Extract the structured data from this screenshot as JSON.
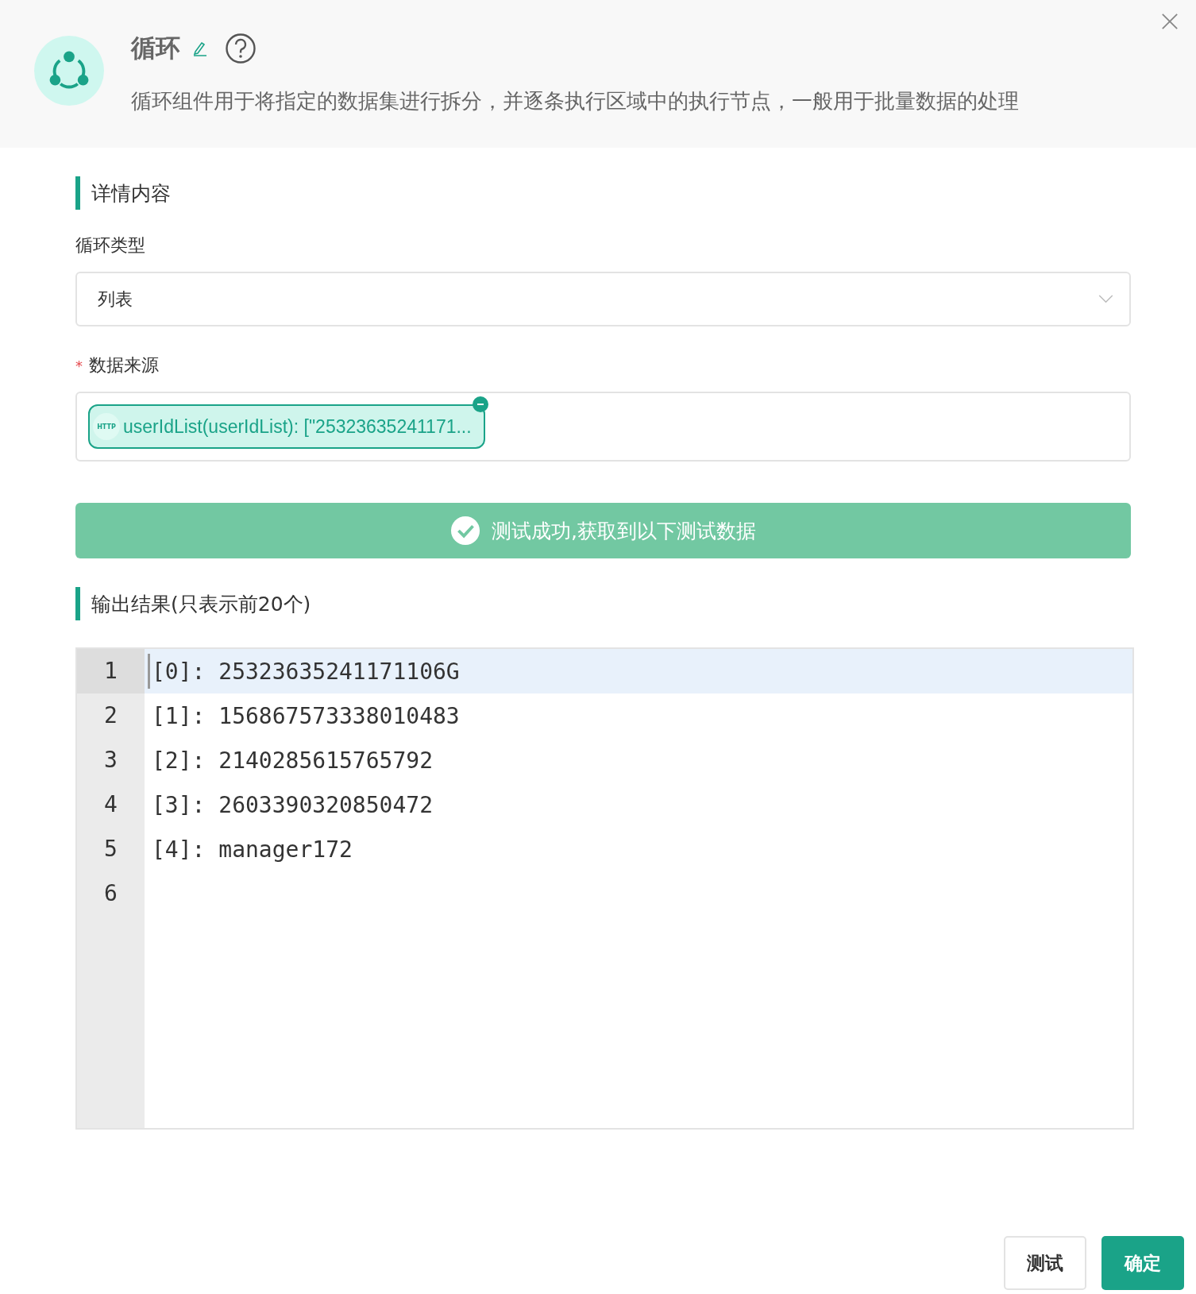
{
  "header": {
    "title": "循环",
    "description": "循环组件用于将指定的数据集进行拆分，并逐条执行区域中的执行节点，一般用于批量数据的处理"
  },
  "sections": [
    {
      "heading": "详情内容"
    }
  ],
  "loop_type": {
    "label": "循环类型",
    "value": "列表"
  },
  "data_source": {
    "required_mark": "*",
    "label": "数据来源",
    "tags": [
      {
        "badge": "HTTP",
        "text": "userIdList(userIdList): [\"25323635241171..."
      }
    ]
  },
  "banner": {
    "kind": "success",
    "text": "测试成功,获取到以下测试数据"
  },
  "output": {
    "heading": "输出结果(只表示前20个)",
    "lines": [
      {
        "number": "1",
        "text": "[0]: 25323635241171106G",
        "active": true
      },
      {
        "number": "2",
        "text": "[1]: 156867573338010483",
        "active": false
      },
      {
        "number": "3",
        "text": "[2]: 2140285615765792",
        "active": false
      },
      {
        "number": "4",
        "text": "[3]: 2603390320850472",
        "active": false
      },
      {
        "number": "5",
        "text": "[4]: manager172",
        "active": false
      },
      {
        "number": "6",
        "active": false
      }
    ]
  },
  "buttons": [
    {
      "label": "测试",
      "kind": "secondary"
    },
    {
      "label": "确定",
      "kind": "primary"
    }
  ]
}
